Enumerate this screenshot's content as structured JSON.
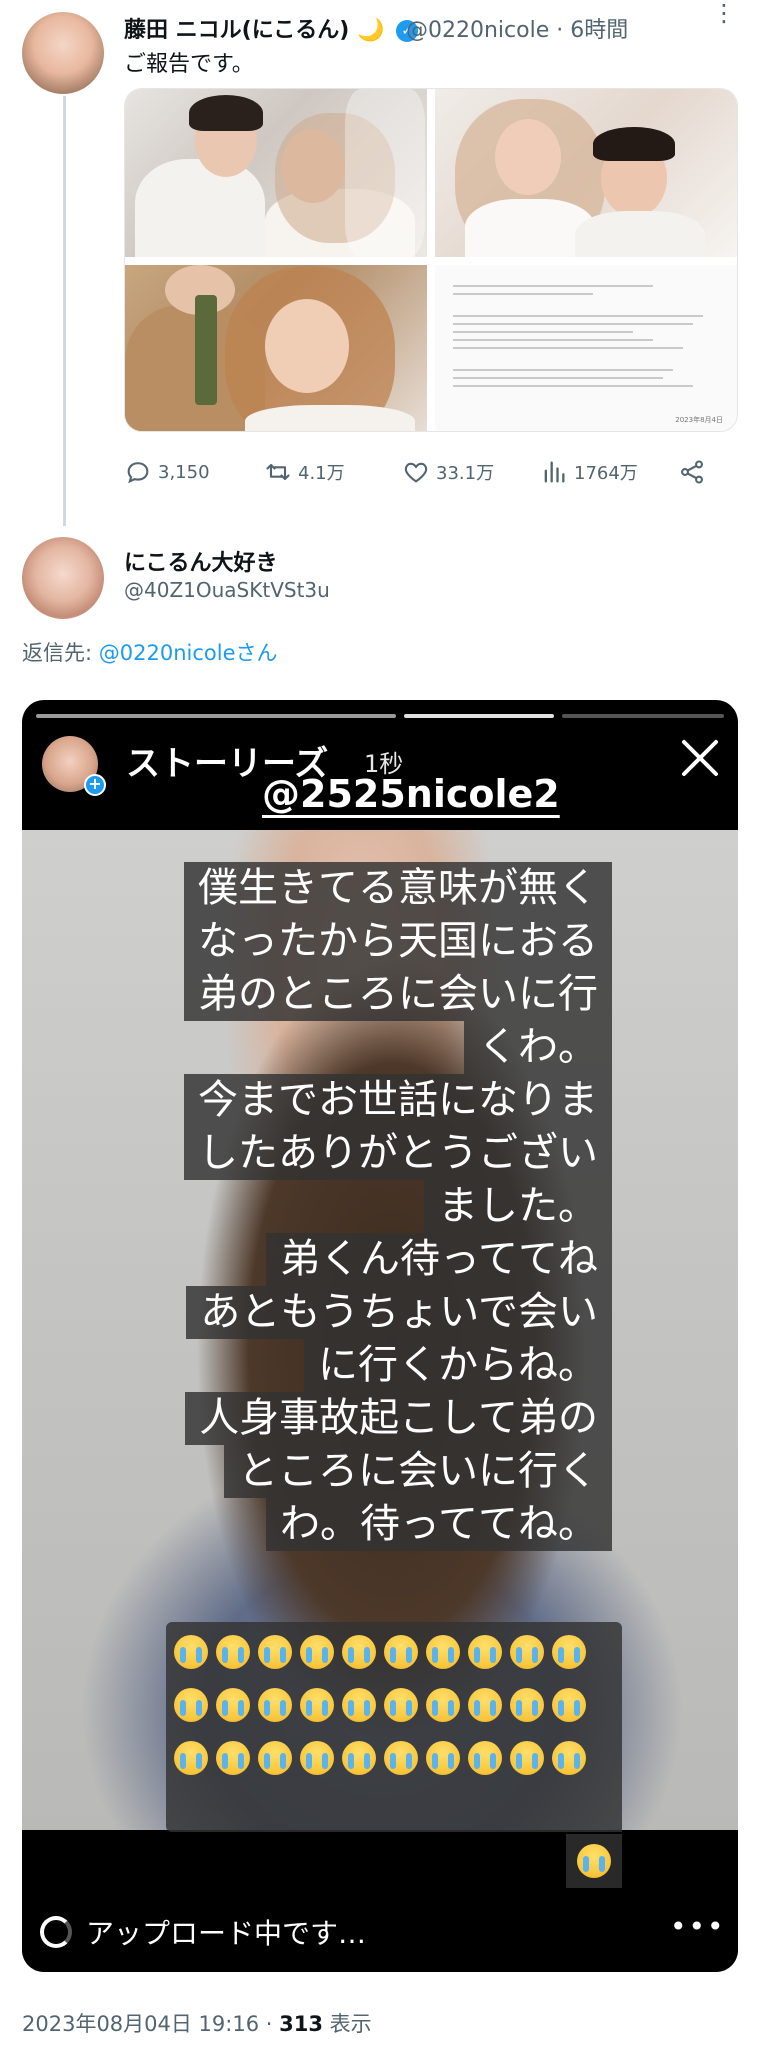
{
  "tweet1": {
    "name": "藤田 ニコル(にこるん)",
    "moon": "🌙",
    "verified": "✓",
    "handle_time": "@0220nicole · 6時間",
    "more": "⋮",
    "text": "ご報告です。",
    "actions": {
      "replies": "3,150",
      "retweets": "4.1万",
      "likes": "33.1万",
      "views": "1764万"
    },
    "document_date": "2023年8月4日"
  },
  "tweet2": {
    "name": "にこるん大好き",
    "handle": "@40Z1OuaSKtVSt3u",
    "reply_label": "返信先: ",
    "reply_target": "@0220nicoleさん"
  },
  "story": {
    "title": "ストーリーズ",
    "time": "1秒",
    "mention": "@2525nicole2",
    "plus": "+",
    "captions": [
      "僕生きてる意味が無く",
      "なったから天国におる",
      "弟のところに会いに行",
      "くわ。",
      "今までお世話になりま",
      "したありがとうござい",
      "ました。",
      "弟くん待っててね",
      "あともうちょいで会い",
      "に行くからね。",
      "人身事故起こして弟の",
      "ところに会いに行く",
      "わ。待っててね。"
    ],
    "upload_text": "アップロード中です…",
    "more": "•••"
  },
  "footer": {
    "timestamp": "2023年08月04日 19:16 · ",
    "views_count": "313",
    "views_label": " 表示"
  },
  "colors": {
    "accent": "#1d9bf0",
    "secondary_text": "#536471",
    "thread_line": "#cfd9de"
  }
}
